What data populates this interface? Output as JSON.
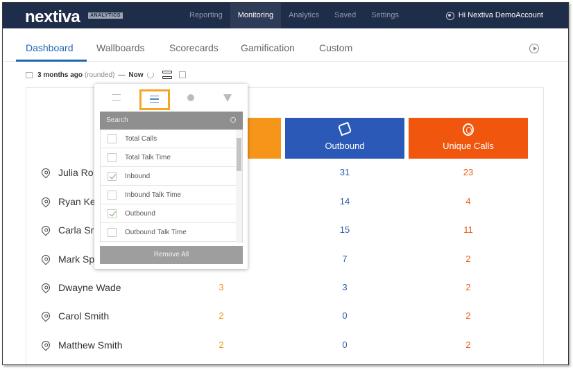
{
  "header": {
    "logo_text": "nextiva",
    "logo_badge": "ANALYTICS",
    "nav": [
      {
        "label": "Reporting",
        "active": false
      },
      {
        "label": "Monitoring",
        "active": true
      },
      {
        "label": "Analytics",
        "active": false
      },
      {
        "label": "Saved",
        "active": false
      },
      {
        "label": "Settings",
        "active": false
      }
    ],
    "account_label": "Hi Nextiva DemoAccount"
  },
  "tabs": [
    {
      "label": "Dashboard",
      "active": true
    },
    {
      "label": "Wallboards",
      "active": false
    },
    {
      "label": "Scorecards",
      "active": false
    },
    {
      "label": "Gamification",
      "active": false
    },
    {
      "label": "Custom",
      "active": false
    }
  ],
  "timerange": {
    "value": "3 months ago",
    "qualifier": "(rounded)",
    "separator": "—",
    "end": "Now"
  },
  "columns": {
    "outbound": "Outbound",
    "unique_calls": "Unique Calls"
  },
  "rows": [
    {
      "name": "Julia Ro",
      "inbound": "",
      "outbound": "31",
      "unique": "23"
    },
    {
      "name": "Ryan Ke",
      "inbound": "",
      "outbound": "14",
      "unique": "4"
    },
    {
      "name": "Carla Sr",
      "inbound": "",
      "outbound": "15",
      "unique": "11"
    },
    {
      "name": "Mark Sp",
      "inbound": "",
      "outbound": "7",
      "unique": "2"
    },
    {
      "name": "Dwayne Wade",
      "inbound": "3",
      "outbound": "3",
      "unique": "2"
    },
    {
      "name": "Carol Smith",
      "inbound": "2",
      "outbound": "0",
      "unique": "2"
    },
    {
      "name": "Matthew Smith",
      "inbound": "2",
      "outbound": "0",
      "unique": "2"
    }
  ],
  "popup": {
    "search_placeholder": "Search",
    "items": [
      {
        "label": "Total Calls",
        "checked": false
      },
      {
        "label": "Total Talk Time",
        "checked": false
      },
      {
        "label": "Inbound",
        "checked": true
      },
      {
        "label": "Inbound Talk Time",
        "checked": false
      },
      {
        "label": "Outbound",
        "checked": true
      },
      {
        "label": "Outbound Talk Time",
        "checked": false
      }
    ],
    "remove_all_label": "Remove All"
  },
  "colors": {
    "navbar": "#1e2d4a",
    "accent_blue": "#1d67b4",
    "inbound_orange": "#f5961b",
    "outbound_blue": "#2b59b8",
    "unique_orange": "#f0560e",
    "highlight": "#f5a623"
  }
}
